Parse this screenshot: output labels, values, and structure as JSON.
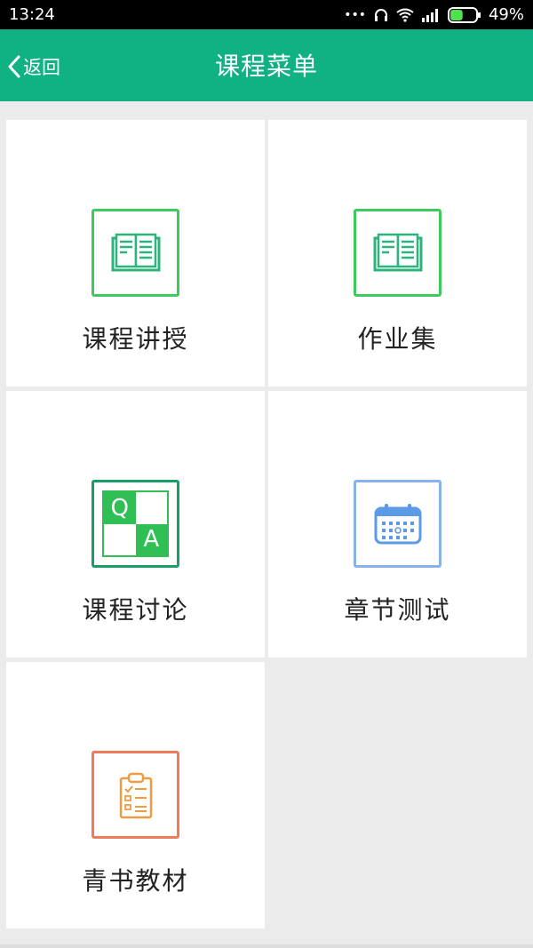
{
  "status": {
    "time": "13:24",
    "dots": "•••",
    "battery_percent": "49%",
    "battery_level": 0.49
  },
  "nav": {
    "back_label": "返回",
    "title": "课程菜单"
  },
  "menu": {
    "items": [
      {
        "label": "课程讲授",
        "icon": "book-icon",
        "color": "#3ecb5d"
      },
      {
        "label": "作业集",
        "icon": "book-icon",
        "color": "#3ecb5d"
      },
      {
        "label": "课程讨论",
        "icon": "qa-icon",
        "color": "#1a9e68",
        "q": "Q",
        "a": "A"
      },
      {
        "label": "章节测试",
        "icon": "calendar-icon",
        "color": "#86b3ea"
      },
      {
        "label": "青书教材",
        "icon": "clipboard-icon",
        "color": "#ef7a5c"
      }
    ]
  },
  "colors": {
    "accent": "#10b183",
    "background": "#ebebeb"
  }
}
